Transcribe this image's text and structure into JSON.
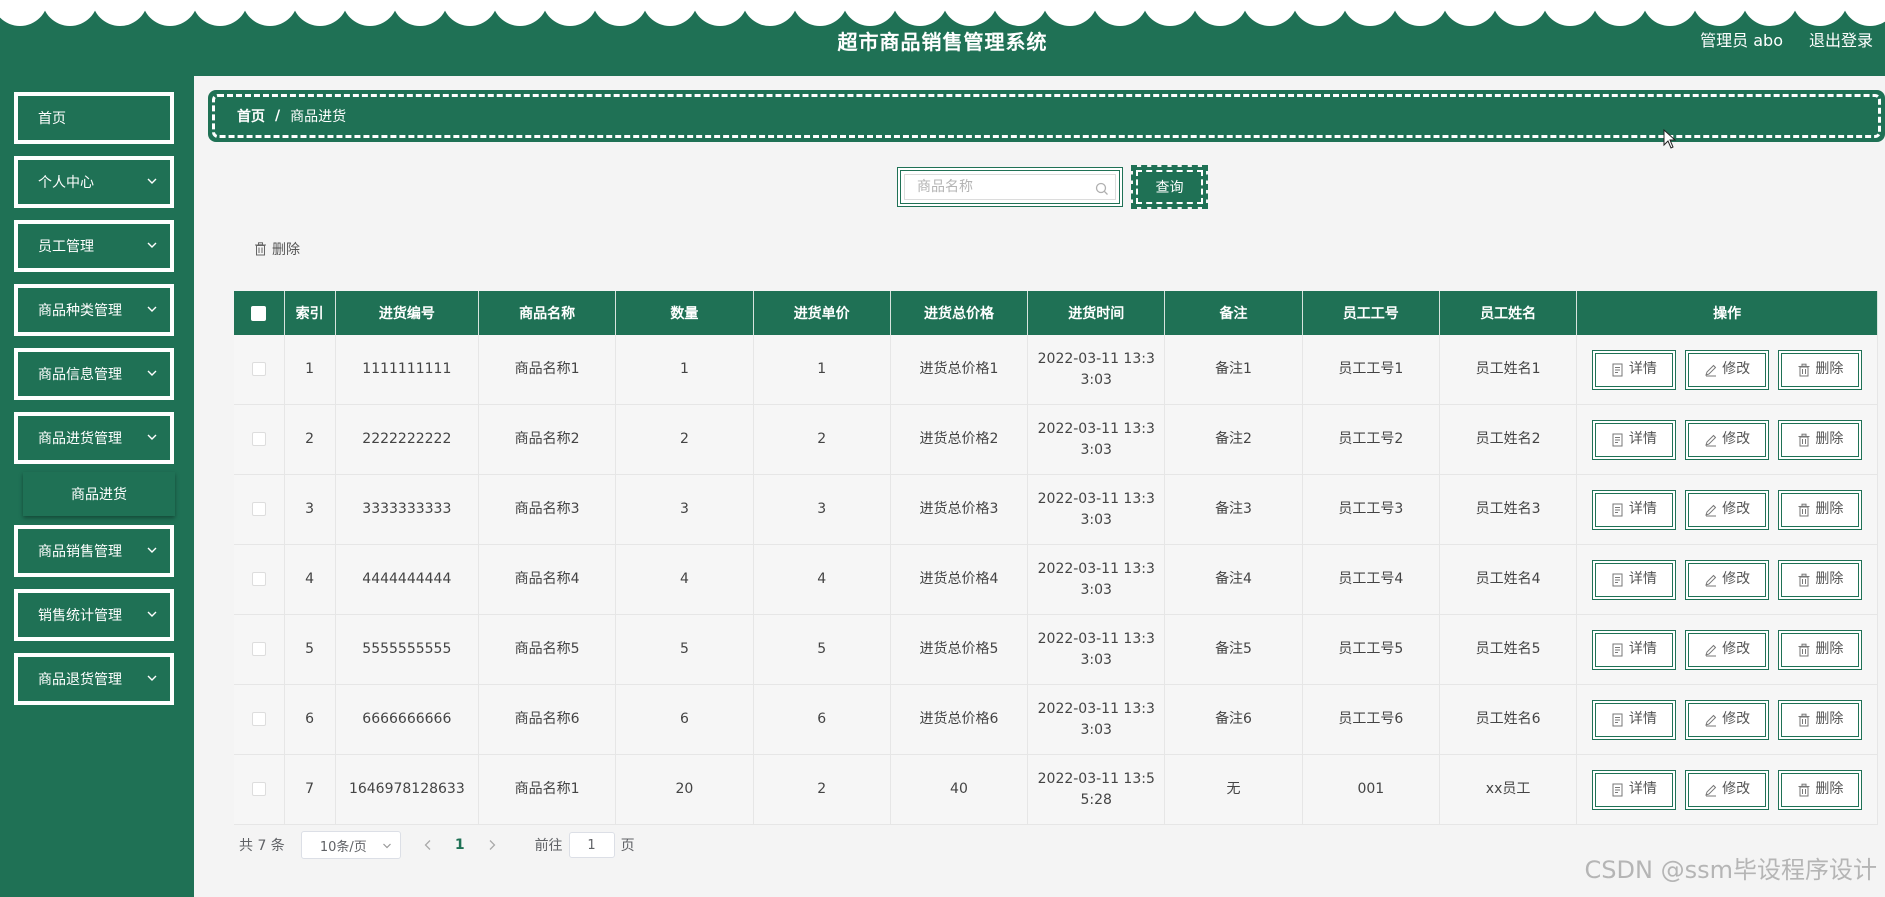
{
  "header": {
    "title": "超市商品销售管理系统",
    "user": "管理员 abo",
    "logout": "退出登录"
  },
  "sidebar": {
    "items": [
      {
        "label": "首页",
        "has_chevron": false
      },
      {
        "label": "个人中心",
        "has_chevron": true
      },
      {
        "label": "员工管理",
        "has_chevron": true
      },
      {
        "label": "商品种类管理",
        "has_chevron": true
      },
      {
        "label": "商品信息管理",
        "has_chevron": true
      },
      {
        "label": "商品进货管理",
        "has_chevron": true
      },
      {
        "label": "商品销售管理",
        "has_chevron": true
      },
      {
        "label": "销售统计管理",
        "has_chevron": true
      },
      {
        "label": "商品退货管理",
        "has_chevron": true
      }
    ],
    "submenu": {
      "label": "商品进货"
    }
  },
  "breadcrumb": {
    "home": "首页",
    "separator": "/",
    "current": "商品进货"
  },
  "search": {
    "placeholder": "商品名称",
    "button": "查询"
  },
  "toolbar": {
    "delete_label": "删除"
  },
  "table": {
    "headers": [
      "索引",
      "进货编号",
      "商品名称",
      "数量",
      "进货单价",
      "进货总价格",
      "进货时间",
      "备注",
      "员工工号",
      "员工姓名",
      "操作"
    ],
    "rows": [
      {
        "index": "1",
        "code": "1111111111",
        "name": "商品名称1",
        "qty": "1",
        "price": "1",
        "total": "进货总价格1",
        "time_l1": "2022-03-11 13:3",
        "time_l2": "3:03",
        "note": "备注1",
        "emp_no": "员工工号1",
        "emp_name": "员工姓名1"
      },
      {
        "index": "2",
        "code": "2222222222",
        "name": "商品名称2",
        "qty": "2",
        "price": "2",
        "total": "进货总价格2",
        "time_l1": "2022-03-11 13:3",
        "time_l2": "3:03",
        "note": "备注2",
        "emp_no": "员工工号2",
        "emp_name": "员工姓名2"
      },
      {
        "index": "3",
        "code": "3333333333",
        "name": "商品名称3",
        "qty": "3",
        "price": "3",
        "total": "进货总价格3",
        "time_l1": "2022-03-11 13:3",
        "time_l2": "3:03",
        "note": "备注3",
        "emp_no": "员工工号3",
        "emp_name": "员工姓名3"
      },
      {
        "index": "4",
        "code": "4444444444",
        "name": "商品名称4",
        "qty": "4",
        "price": "4",
        "total": "进货总价格4",
        "time_l1": "2022-03-11 13:3",
        "time_l2": "3:03",
        "note": "备注4",
        "emp_no": "员工工号4",
        "emp_name": "员工姓名4"
      },
      {
        "index": "5",
        "code": "5555555555",
        "name": "商品名称5",
        "qty": "5",
        "price": "5",
        "total": "进货总价格5",
        "time_l1": "2022-03-11 13:3",
        "time_l2": "3:03",
        "note": "备注5",
        "emp_no": "员工工号5",
        "emp_name": "员工姓名5"
      },
      {
        "index": "6",
        "code": "6666666666",
        "name": "商品名称6",
        "qty": "6",
        "price": "6",
        "total": "进货总价格6",
        "time_l1": "2022-03-11 13:3",
        "time_l2": "3:03",
        "note": "备注6",
        "emp_no": "员工工号6",
        "emp_name": "员工姓名6"
      },
      {
        "index": "7",
        "code": "1646978128633",
        "name": "商品名称1",
        "qty": "20",
        "price": "2",
        "total": "40",
        "time_l1": "2022-03-11 13:5",
        "time_l2": "5:28",
        "note": "无",
        "emp_no": "001",
        "emp_name": "xx员工"
      }
    ],
    "actions": {
      "detail": "详情",
      "edit": "修改",
      "delete": "删除"
    }
  },
  "pagination": {
    "total": "共 7 条",
    "page_size": "10条/页",
    "current_page": "1",
    "goto_label": "前往",
    "goto_value": "1",
    "page_unit": "页"
  },
  "watermark": "CSDN @ssm毕设程序设计",
  "colors": {
    "primary": "#1f7155",
    "background": "#f4f4f4"
  }
}
